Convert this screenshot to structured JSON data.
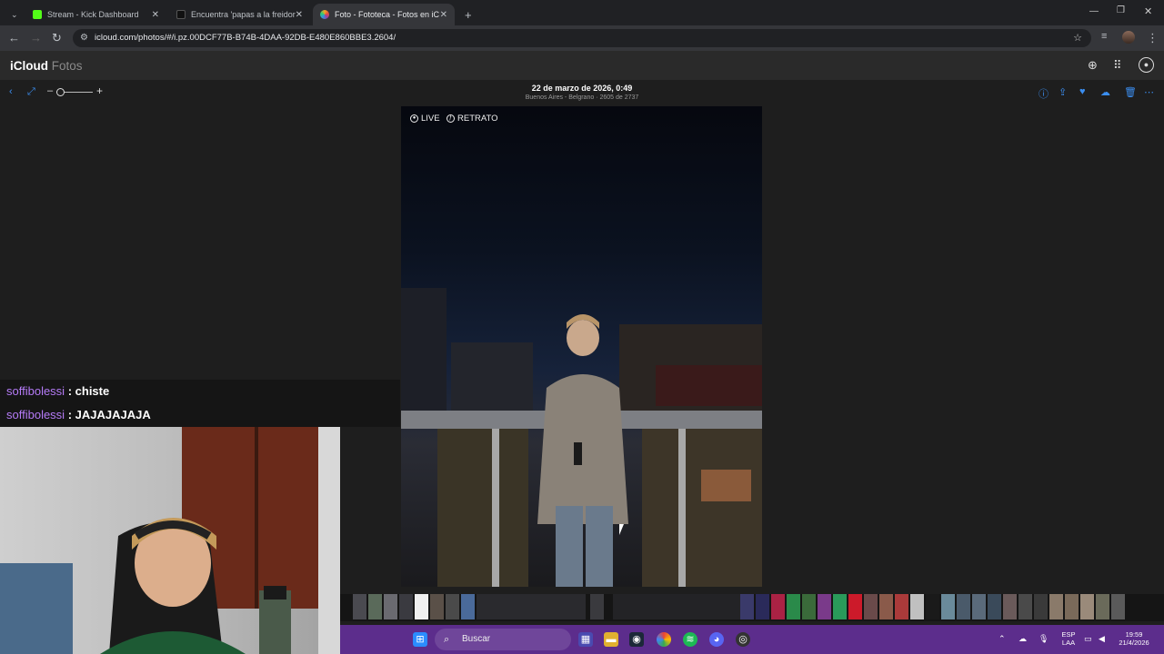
{
  "browser": {
    "tabs": [
      {
        "title": "Stream - Kick Dashboard",
        "favicon_color": "#53fc18"
      },
      {
        "title": "Encuentra 'papas a la freidora de",
        "favicon_color": "#111111"
      },
      {
        "title": "Foto - Fototeca - Fotos en iCloud",
        "favicon_color": "#f5a623"
      }
    ],
    "new_tab": "+",
    "url": "icloud.com/photos/#/i.pz.00DCF77B-B74B-4DAA-92DB-E480E860BBE3.2604/"
  },
  "app": {
    "brand_main": "iCloud",
    "brand_sub": "Fotos"
  },
  "photo": {
    "date": "22 de marzo de 2026, 0:49",
    "location": "Buenos Aires - Belgrano · 2605 de 2737",
    "badges": [
      "LIVE",
      "RETRATO"
    ]
  },
  "chat": [
    {
      "user": "soffibolessi",
      "message": ": chiste"
    },
    {
      "user": "soffibolessi",
      "message": ": JAJAJAJAJA"
    }
  ],
  "taskbar": {
    "search_placeholder": "Buscar",
    "lang_top": "ESP",
    "lang_bottom": "LAA",
    "time": "19:59",
    "date": "21/4/2026"
  },
  "colors": {
    "accent": "#3b8ef0",
    "chat_user": "#b57bf7",
    "taskbar": "#5c2d8c"
  }
}
